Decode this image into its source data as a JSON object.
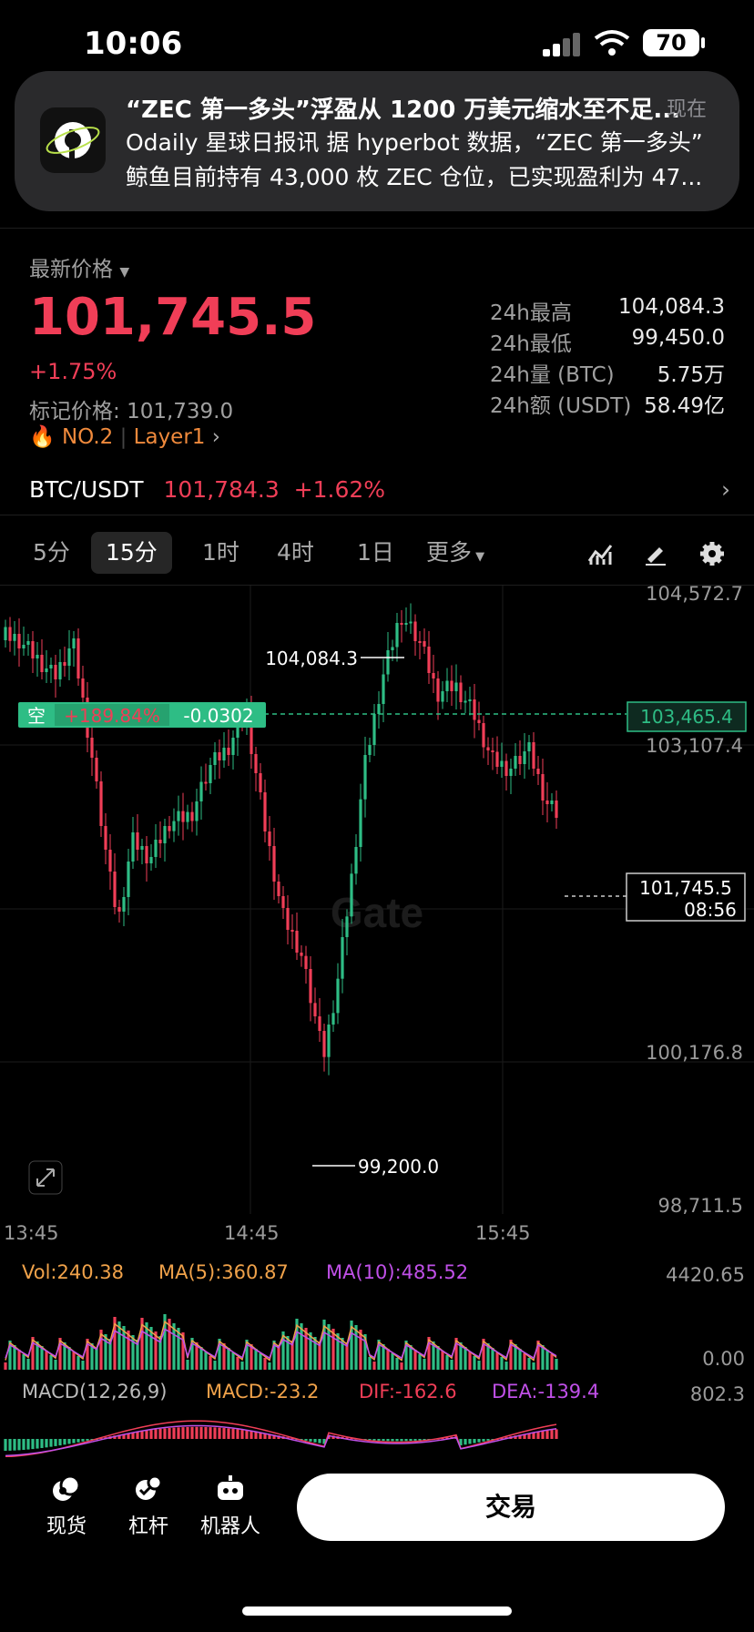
{
  "status_bar": {
    "time": "10:06",
    "battery": "70"
  },
  "notification": {
    "title": "“ZEC 第一多头”浮盈从 1200 万美元缩水至不足...",
    "time": "现在",
    "body_line1": "Odaily 星球日报讯 据 hyperbot 数据，“ZEC 第一多头”",
    "body_line2": "鲸鱼目前持有 43,000 枚 ZEC 仓位，已实现盈利为 47..."
  },
  "price": {
    "label": "最新价格",
    "last": "101,745.5",
    "change_pct": "+1.75%",
    "mark_label": "标记价格:",
    "mark_value": "101,739.0",
    "rank": "NO.2",
    "category": "Layer1"
  },
  "stats": [
    {
      "label": "24h最高",
      "value": "104,084.3"
    },
    {
      "label": "24h最低",
      "value": "99,450.0"
    },
    {
      "label": "24h量 (BTC)",
      "value": "5.75万"
    },
    {
      "label": "24h额 (USDT)",
      "value": "58.49亿"
    }
  ],
  "pair": {
    "symbol": "BTC/USDT",
    "price": "101,784.3",
    "change": "+1.62%"
  },
  "timeframes": [
    "5分",
    "15分",
    "1时",
    "4时",
    "1日",
    "更多"
  ],
  "active_timeframe": "15分",
  "chart": {
    "y_ticks": [
      "104,572.7",
      "103,107.4",
      "100,176.8",
      "98,711.5"
    ],
    "x_ticks": [
      "13:45",
      "14:45",
      "15:45"
    ],
    "high_marker": "104,084.3",
    "low_marker": "99,200.0",
    "position": {
      "side": "空",
      "pnl": "+189.84%",
      "qty": "-0.0302",
      "price": "103,465.4"
    },
    "current_price_tag": "101,745.5",
    "countdown": "08:56",
    "watermark": "Gate",
    "colors": {
      "up": "#2ebd85",
      "down": "#f03e57",
      "ma5": "#f0a24a",
      "ma10": "#c050e8"
    }
  },
  "volume": {
    "vol": "Vol:240.38",
    "ma5": "MA(5):360.87",
    "ma10": "MA(10):485.52",
    "top": "4420.65",
    "bottom": "0.00"
  },
  "macd": {
    "label": "MACD(12,26,9)",
    "macd": "MACD:-23.2",
    "dif": "DIF:-162.6",
    "dea": "DEA:-139.4",
    "top": "802.3"
  },
  "bottom_nav": {
    "spot": "现货",
    "leverage": "杠杆",
    "bot": "机器人",
    "trade": "交易"
  }
}
